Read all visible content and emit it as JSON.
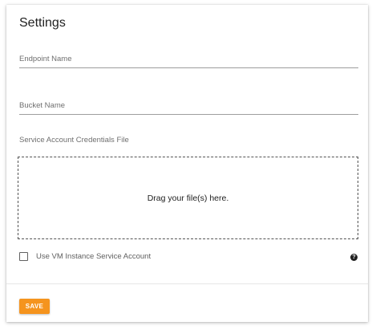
{
  "settings": {
    "title": "Settings",
    "fields": [
      {
        "label": "Endpoint Name",
        "value": ""
      },
      {
        "label": "Bucket Name",
        "value": ""
      }
    ],
    "credentials": {
      "label": "Service Account Credentials File",
      "dropzone_text": "Drag your file(s) here."
    },
    "vm_option": {
      "label": "Use VM Instance Service Account",
      "checked": false,
      "help_icon": "help-circle-icon",
      "help_glyph": "?"
    },
    "actions": {
      "save_label": "SAVE",
      "save_color": "#f5941e"
    }
  }
}
